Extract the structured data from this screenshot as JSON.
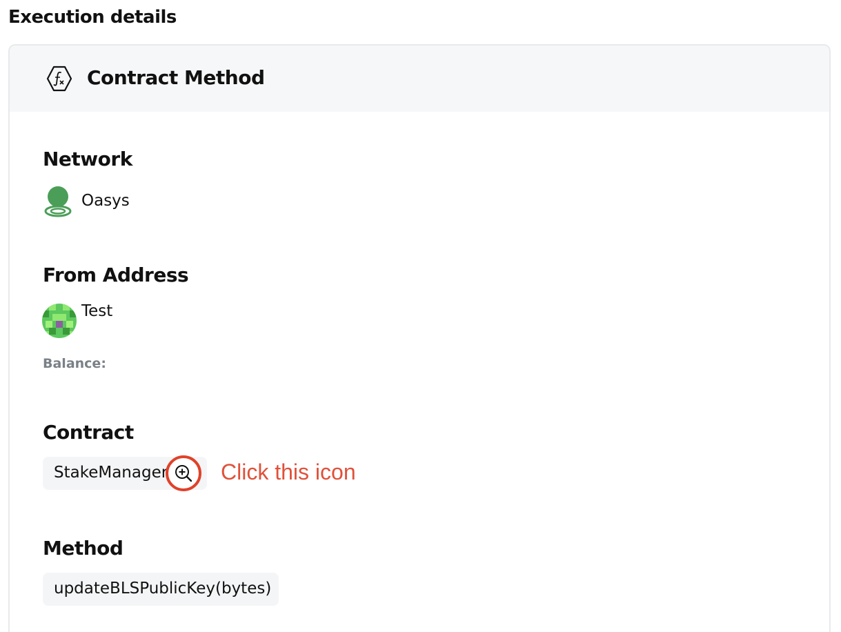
{
  "section": {
    "title": "Execution details"
  },
  "card": {
    "header_title": "Contract Method",
    "header_icon": "function-hexagon-icon"
  },
  "network": {
    "label": "Network",
    "value": "Oasys",
    "icon": "oasys-logo-icon",
    "icon_color": "#4a9e58"
  },
  "from_address": {
    "label": "From Address",
    "name": "Test",
    "avatar": "identicon-avatar",
    "balance_label": "Balance:"
  },
  "contract": {
    "label": "Contract",
    "value": "StakeManager",
    "icon": "zoom-in-icon",
    "annotation": "Click this icon",
    "annotation_color": "#e0513a"
  },
  "method": {
    "label": "Method",
    "value": "updateBLSPublicKey(bytes)"
  }
}
